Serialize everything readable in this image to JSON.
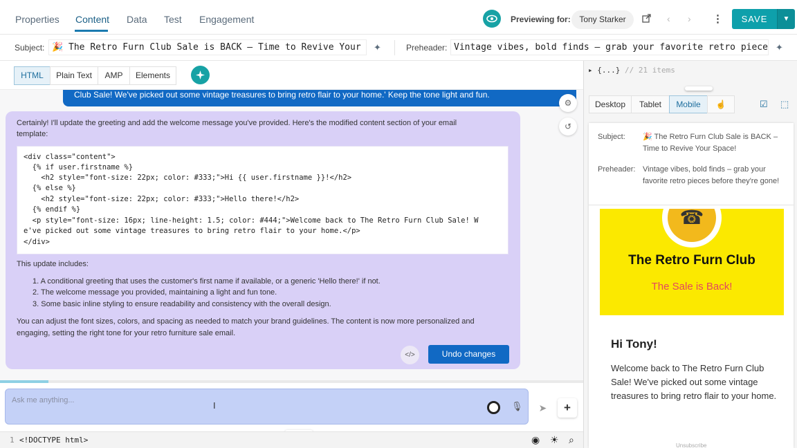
{
  "nav": {
    "tabs": [
      "Properties",
      "Content",
      "Data",
      "Test",
      "Engagement"
    ],
    "active_tab": "Content",
    "previewing_label": "Previewing for:",
    "preview_user": "Tony Starker",
    "more_icon": "more-vertical-icon",
    "save_label": "SAVE"
  },
  "fields": {
    "subject_label": "Subject:",
    "subject_value": "🎉 The Retro Furn Club Sale is BACK – Time to Revive Your",
    "preheader_label": "Preheader:",
    "preheader_value": "Vintage vibes, bold finds – grab your favorite retro pieces"
  },
  "editor": {
    "modes": [
      "HTML",
      "Plain Text",
      "AMP",
      "Elements"
    ],
    "active_mode": "HTML"
  },
  "chat": {
    "user_message": "Club Sale! We've picked out some vintage treasures to bring retro flair to your home.' Keep the tone light and fun.",
    "ai_intro_1": "Certainly! I'll update the greeting and add the welcome message you've provided. Here's the modified content section of your email",
    "ai_intro_2": "template:",
    "code_lines": [
      "<div class=\"content\">",
      "  {% if user.firstname %}",
      "    <h2 style=\"font-size: 22px; color: #333;\">Hi {{ user.firstname }}!</h2>",
      "  {% else %}",
      "    <h2 style=\"font-size: 22px; color: #333;\">Hello there!</h2>",
      "  {% endif %}",
      "  <p style=\"font-size: 16px; line-height: 1.5; color: #444;\">Welcome back to The Retro Furn Club Sale! W",
      "e've picked out some vintage treasures to bring retro flair to your home.</p>",
      "</div>"
    ],
    "update_heading": "This update includes:",
    "update_items": [
      "1. A conditional greeting that uses the customer's first name if available, or a generic 'Hello there!' if not.",
      "2. The welcome message you provided, maintaining a light and fun tone.",
      "3. Some basic inline styling to ensure readability and consistency with the overall design."
    ],
    "closing_1": "You can adjust the font sizes, colors, and spacing as needed to match your brand guidelines. The content is now more personalized and",
    "closing_2": "engaging, setting the right tone for your retro furniture sale email.",
    "code_toggle": "</>",
    "undo_label": "Undo changes",
    "input_placeholder": "Ask me anything...",
    "plus": "+"
  },
  "code_footer": {
    "line_number": "1",
    "line_text": "<!DOCTYPE html>"
  },
  "preview": {
    "json_summary": "▸ {...}",
    "json_comment": "// 21 items",
    "devices": [
      "Desktop",
      "Tablet",
      "Mobile"
    ],
    "active_device": "Mobile",
    "subject_label": "Subject:",
    "subject_value": "🎉 The Retro Furn Club Sale is BACK – Time to Revive Your Space!",
    "preheader_label": "Preheader:",
    "preheader_value": "Vintage vibes, bold finds – grab your favorite retro pieces before they're gone!",
    "hero_title": "The Retro Furn Club",
    "hero_subtitle": "The Sale is Back!",
    "greeting": "Hi Tony!",
    "body": "Welcome back to The Retro Furn Club Sale! We've picked out some vintage treasures to bring retro flair to your home.",
    "footer_link": "Unsubscribe"
  },
  "progress": 0.083,
  "colors": {
    "accent": "#17a2a5",
    "primary_button": "#1169c4",
    "ai_bubble": "#d9d0f7",
    "hero_bg": "#fbe900",
    "hero_subtitle": "#e4475f"
  }
}
